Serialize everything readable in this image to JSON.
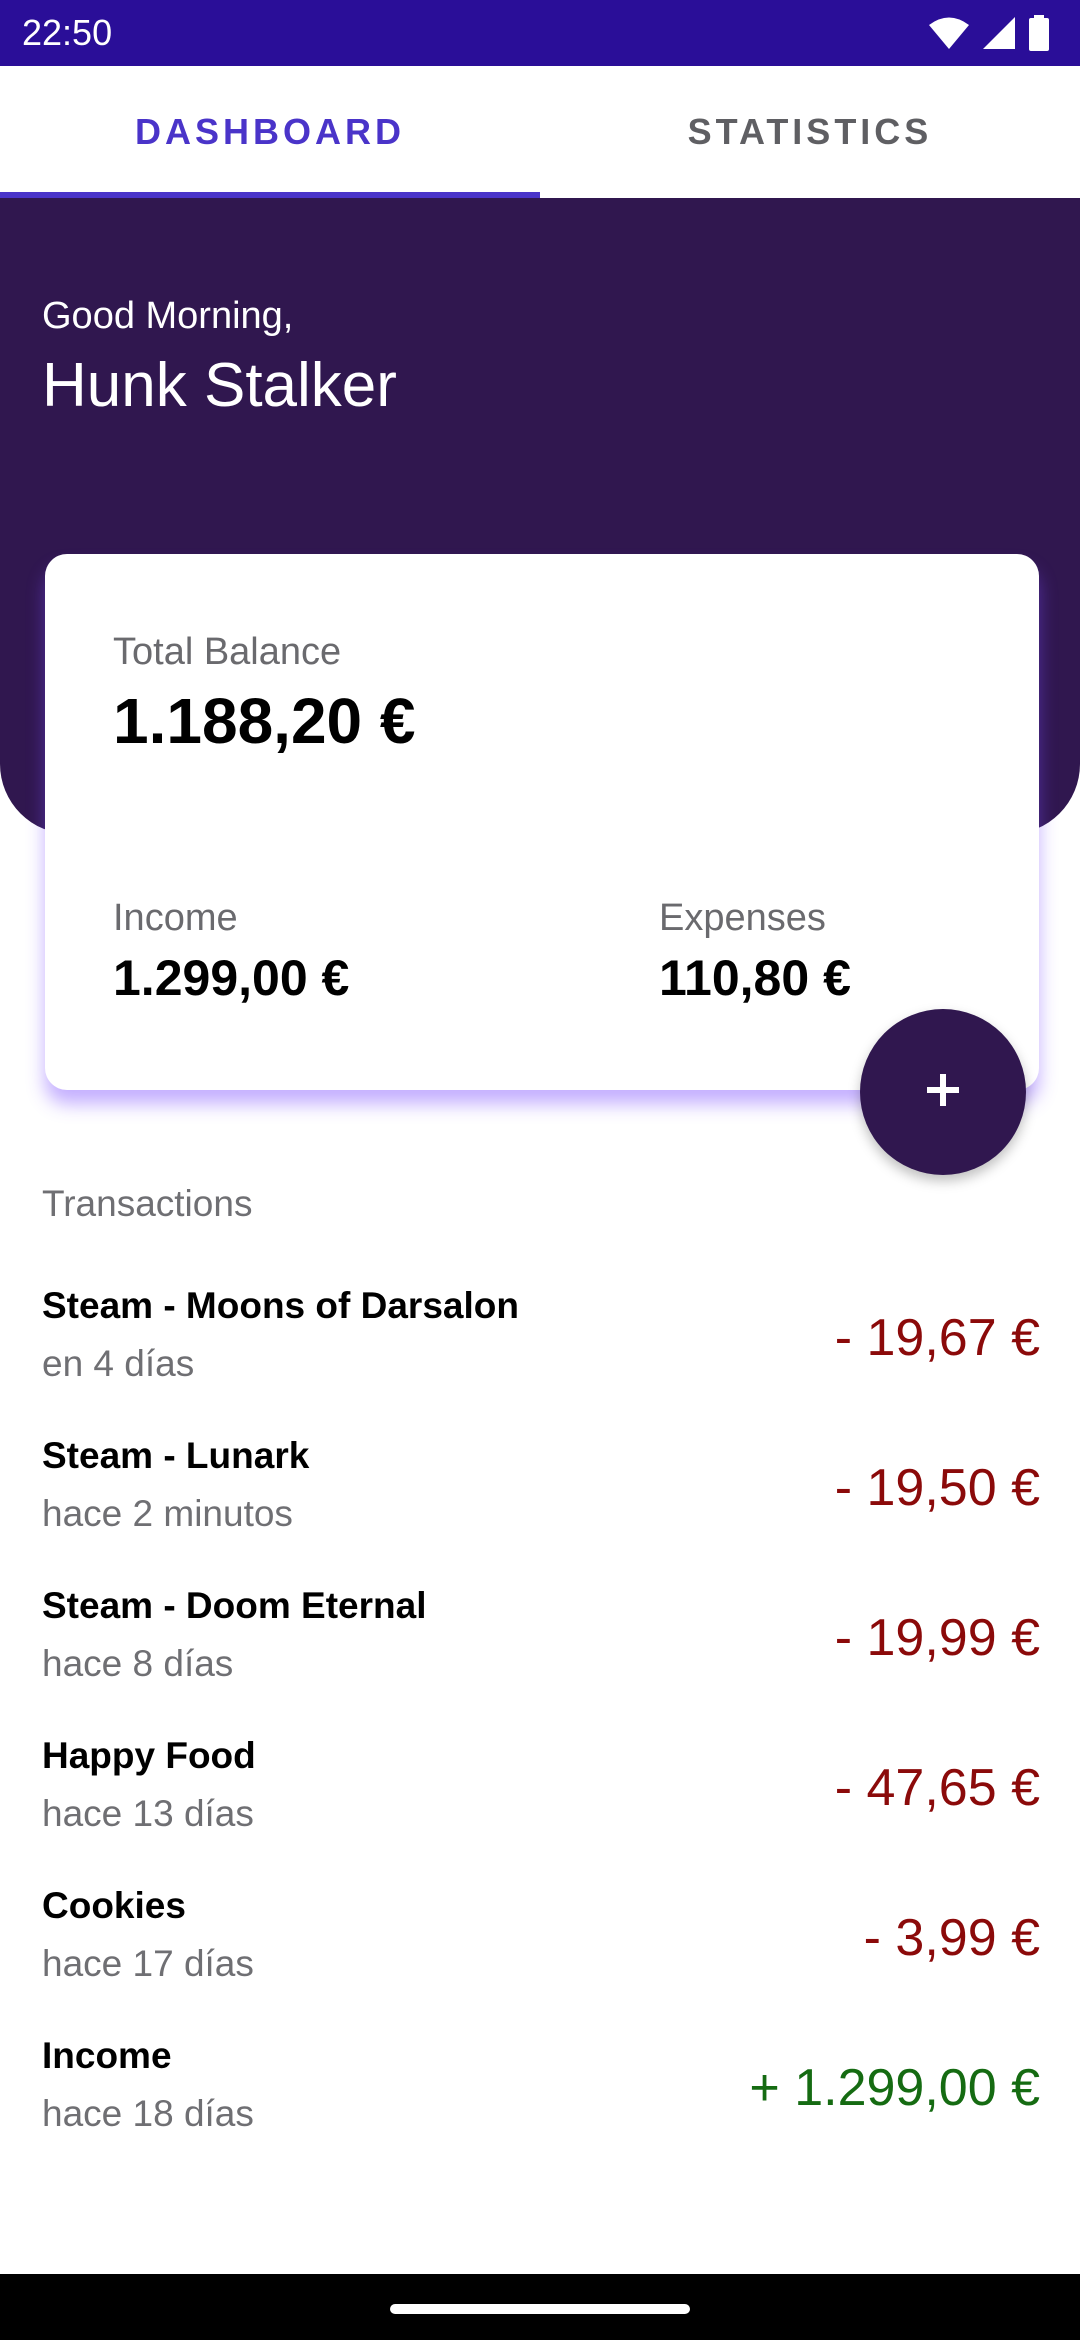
{
  "status_bar": {
    "time": "22:50",
    "icons": [
      "wifi-icon",
      "signal-icon",
      "battery-icon"
    ]
  },
  "tabs": [
    {
      "label": "DASHBOARD",
      "active": true
    },
    {
      "label": "STATISTICS",
      "active": false
    }
  ],
  "header": {
    "greeting": "Good Morning,",
    "user_name": "Hunk Stalker"
  },
  "card": {
    "total_label": "Total Balance",
    "total_value": "1.188,20 €",
    "income_label": "Income",
    "income_value": "1.299,00 €",
    "expenses_label": "Expenses",
    "expenses_value": "110,80 €"
  },
  "fab": {
    "icon": "plus-icon",
    "symbol": "+"
  },
  "transactions": {
    "title": "Transactions",
    "items": [
      {
        "name": "Steam - Moons of Darsalon",
        "date": "en 4 días",
        "amount": "- 19,67 €",
        "type": "expense"
      },
      {
        "name": "Steam - Lunark",
        "date": "hace 2 minutos",
        "amount": "- 19,50 €",
        "type": "expense"
      },
      {
        "name": "Steam - Doom Eternal",
        "date": "hace 8 días",
        "amount": "- 19,99 €",
        "type": "expense"
      },
      {
        "name": "Happy Food",
        "date": "hace 13 días",
        "amount": "- 47,65 €",
        "type": "expense"
      },
      {
        "name": "Cookies",
        "date": "hace 17 días",
        "amount": "- 3,99 €",
        "type": "expense"
      },
      {
        "name": "Income",
        "date": "hace 18 días",
        "amount": "+ 1.299,00 €",
        "type": "income"
      }
    ]
  },
  "colors": {
    "status_bar": "#2a0e98",
    "header": "#30174f",
    "accent": "#4a34c9",
    "expense": "#8b0a0a",
    "income": "#156b12"
  }
}
